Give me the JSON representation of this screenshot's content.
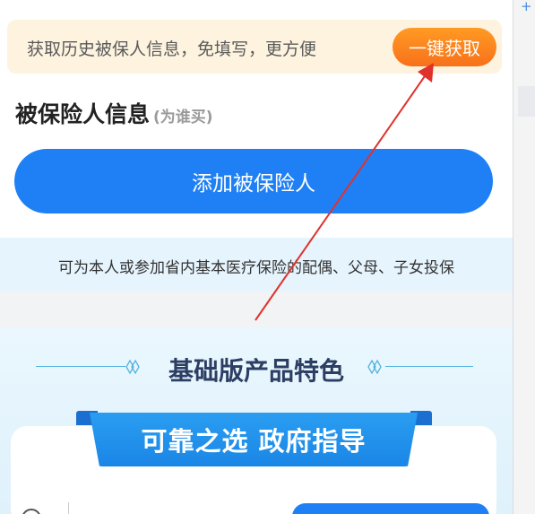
{
  "banner": {
    "text": "获取历史被保人信息，免填写，更方便",
    "button_label": "一键获取"
  },
  "insured": {
    "title": "被保险人信息",
    "subtitle": "(为谁买)",
    "add_button_label": "添加被保险人",
    "hint": "可为本人或参加省内基本医疗保险的配偶、父母、子女投保"
  },
  "features": {
    "title": "基础版产品特色",
    "ribbon_text": "可靠之选 政府指导"
  },
  "window": {
    "new_tab_symbol": "+"
  },
  "colors": {
    "primary_blue": "#1f80f5",
    "orange": "#f8711a",
    "banner_bg": "#fdf3df",
    "hint_bg": "#e6f4fd",
    "annotation_arrow": "#e0322c"
  }
}
